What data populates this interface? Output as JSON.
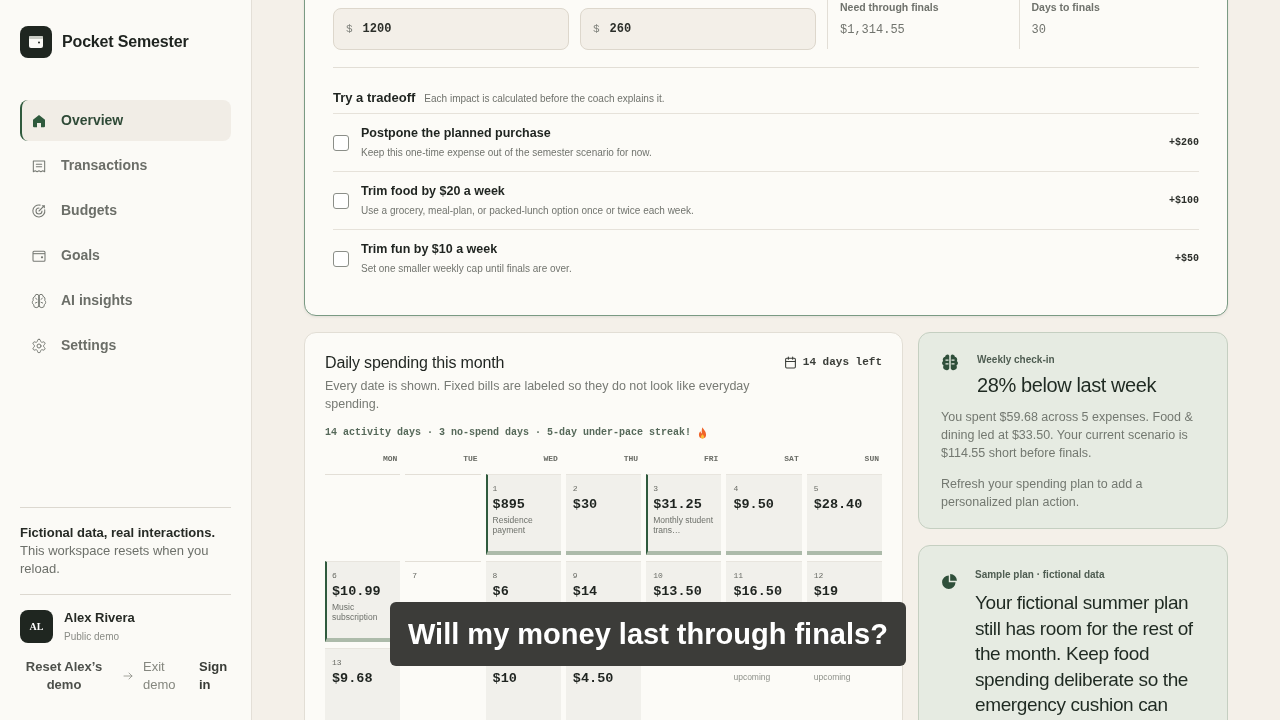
{
  "sidebar": {
    "brand": "Pocket Semester",
    "nav": [
      {
        "label": "Overview",
        "selected": true
      },
      {
        "label": "Transactions",
        "selected": false
      },
      {
        "label": "Budgets",
        "selected": false
      },
      {
        "label": "Goals",
        "selected": false
      },
      {
        "label": "AI insights",
        "selected": false
      },
      {
        "label": "Settings",
        "selected": false
      }
    ],
    "notice": {
      "title": "Fictional data, real interactions.",
      "text": "This workspace resets when you reload."
    },
    "user": {
      "initials": "AL",
      "name": "Alex Rivera",
      "role": "Public demo"
    },
    "actions": [
      {
        "label": "Reset Alex’s demo",
        "kind": "reset"
      },
      {
        "label": "Exit demo",
        "kind": "exit"
      },
      {
        "label": "Sign in",
        "kind": "signin"
      }
    ]
  },
  "scenario": {
    "inputs": [
      {
        "prefix": "$",
        "value": "1200"
      },
      {
        "prefix": "$",
        "value": "260"
      }
    ],
    "stats": [
      {
        "label": "Need through finals",
        "value": "$1,314.55"
      },
      {
        "label": "Days to finals",
        "value": "30"
      }
    ],
    "tradeoffs": {
      "title": "Try a tradeoff",
      "hint": "Each impact is calculated before the coach explains it.",
      "items": [
        {
          "title": "Postpone the planned purchase",
          "description": "Keep this one-time expense out of the semester scenario for now.",
          "impact": "+$260",
          "checked": false
        },
        {
          "title": "Trim food by $20 a week",
          "description": "Use a grocery, meal-plan, or packed-lunch option once or twice each week.",
          "impact": "+$100",
          "checked": false
        },
        {
          "title": "Trim fun by $10 a week",
          "description": "Set one smaller weekly cap until finals are over.",
          "impact": "+$50",
          "checked": false
        }
      ]
    }
  },
  "daily_spending": {
    "title": "Daily spending this month",
    "days_left": "14 days left",
    "description": "Every date is shown. Fixed bills are labeled so they do not look like everyday spending.",
    "summary": "14 activity days · 3 no-spend days · 5-day under-pace streak!",
    "weekdays": [
      "MON",
      "TUE",
      "WED",
      "THU",
      "FRI",
      "SAT",
      "SUN"
    ],
    "weeks": [
      [
        {
          "kind": "empty"
        },
        {
          "kind": "empty"
        },
        {
          "kind": "bill",
          "day": "1",
          "amount": "$895",
          "note": "Residence payment"
        },
        {
          "kind": "spend",
          "day": "2",
          "amount": "$30"
        },
        {
          "kind": "bill",
          "day": "3",
          "amount": "$31.25",
          "note": "Monthly student trans…"
        },
        {
          "kind": "spend",
          "day": "4",
          "amount": "$9.50"
        },
        {
          "kind": "spend",
          "day": "5",
          "amount": "$28.40"
        }
      ],
      [
        {
          "kind": "bill",
          "day": "6",
          "amount": "$10.99",
          "note": "Music subscription"
        },
        {
          "kind": "empty",
          "day": "7"
        },
        {
          "kind": "spend",
          "day": "8",
          "amount": "$6"
        },
        {
          "kind": "spend",
          "day": "9",
          "amount": "$14"
        },
        {
          "kind": "spend",
          "day": "10",
          "amount": "$13.50"
        },
        {
          "kind": "spend",
          "day": "11",
          "amount": "$16.50"
        },
        {
          "kind": "spend",
          "day": "12",
          "amount": "$19"
        }
      ],
      [
        {
          "kind": "spend",
          "day": "13",
          "amount": "$9.68"
        },
        {
          "kind": "empty"
        },
        {
          "kind": "spend",
          "amount": "$10"
        },
        {
          "kind": "spend",
          "amount": "$4.50"
        },
        {
          "kind": "empty"
        },
        {
          "kind": "empty",
          "note": "upcoming"
        },
        {
          "kind": "empty",
          "note": "upcoming"
        }
      ]
    ]
  },
  "weekly_checkin": {
    "label": "Weekly check-in",
    "headline": "28% below last week",
    "body": "You spent $59.68 across 5 expenses. Food & dining led at $33.50. Your current scenario is $114.55 short before finals.",
    "footnote": "Refresh your spending plan to add a personalized plan action."
  },
  "sample_plan": {
    "label": "Sample plan · fictional data",
    "text": "Your fictional summer plan still has room for the rest of the month. Keep food spending deliberate so the emergency cushion can"
  },
  "caption": "Will my money last through finals?"
}
